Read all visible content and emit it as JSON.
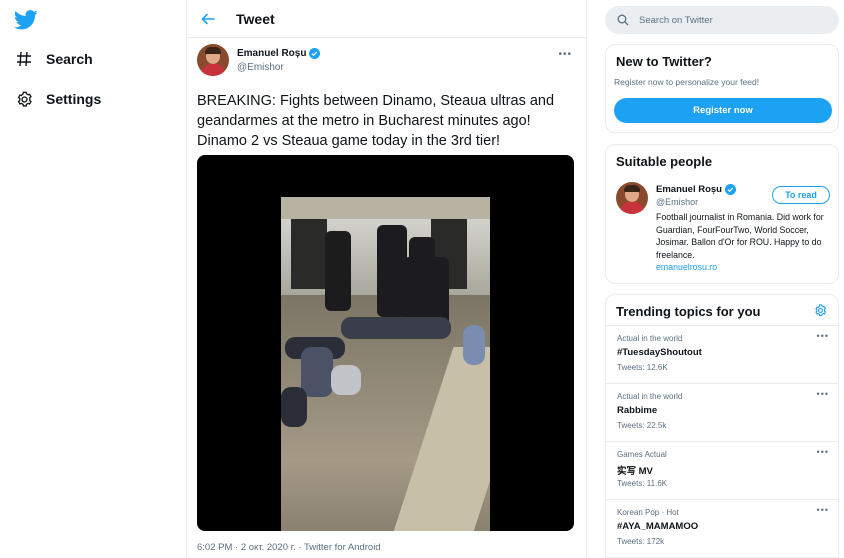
{
  "colors": {
    "accent": "#1da1f2",
    "secondary_text": "#5b7083",
    "border": "#e6ecf0",
    "search_bg": "#ebeef0"
  },
  "nav": {
    "logo_icon": "twitter-bird-icon",
    "items": [
      {
        "icon": "hash-icon",
        "label": "Search"
      },
      {
        "icon": "gear-icon",
        "label": "Settings"
      }
    ]
  },
  "header": {
    "back_icon": "back-arrow-icon",
    "title": "Tweet"
  },
  "tweet": {
    "author_name": "Emanuel Roșu",
    "author_handle": "@Emishor",
    "more": "•••",
    "text": "BREAKING: Fights between Dinamo, Steaua ultras and geandarmes at the metro in Bucharest minutes ago! Dinamo 2 vs Steaua game today in the 3rd tier!",
    "timestamp": "6:02 PM · 2 окт. 2020 г. · Twitter for Android"
  },
  "search": {
    "placeholder": "Search on Twitter"
  },
  "new_to_twitter": {
    "title": "New to Twitter?",
    "subtitle": "Register now to personalize your feed!",
    "button": "Register now"
  },
  "suitable_people": {
    "title": "Suitable people",
    "name": "Emanuel Roșu",
    "handle": "@Emishor",
    "button": "To read",
    "bio": "Football journalist in Romania. Did work for Guardian, FourFourTwo, World Soccer, Josimar. Ballon d'Or for ROU. Happy to do freelance.",
    "link": "emanuelrosu.ro"
  },
  "trends": {
    "title": "Trending topics for you",
    "items": [
      {
        "category": "Actual in the world",
        "name": "#TuesdayShoutout",
        "count": "Tweets: 12.6K",
        "more": "•••"
      },
      {
        "category": "Actual in the world",
        "name": "Rabbime",
        "count": "Tweets: 22.5k",
        "more": "•••"
      },
      {
        "category": "Games Actual",
        "name": "实写 MV",
        "count": "Tweets: 11.6K",
        "more": "•••"
      },
      {
        "category": "Korean Pop · Hot",
        "name": "#AYA_MAMAMOO",
        "count": "Tweets: 172k",
        "more": "•••"
      }
    ]
  }
}
